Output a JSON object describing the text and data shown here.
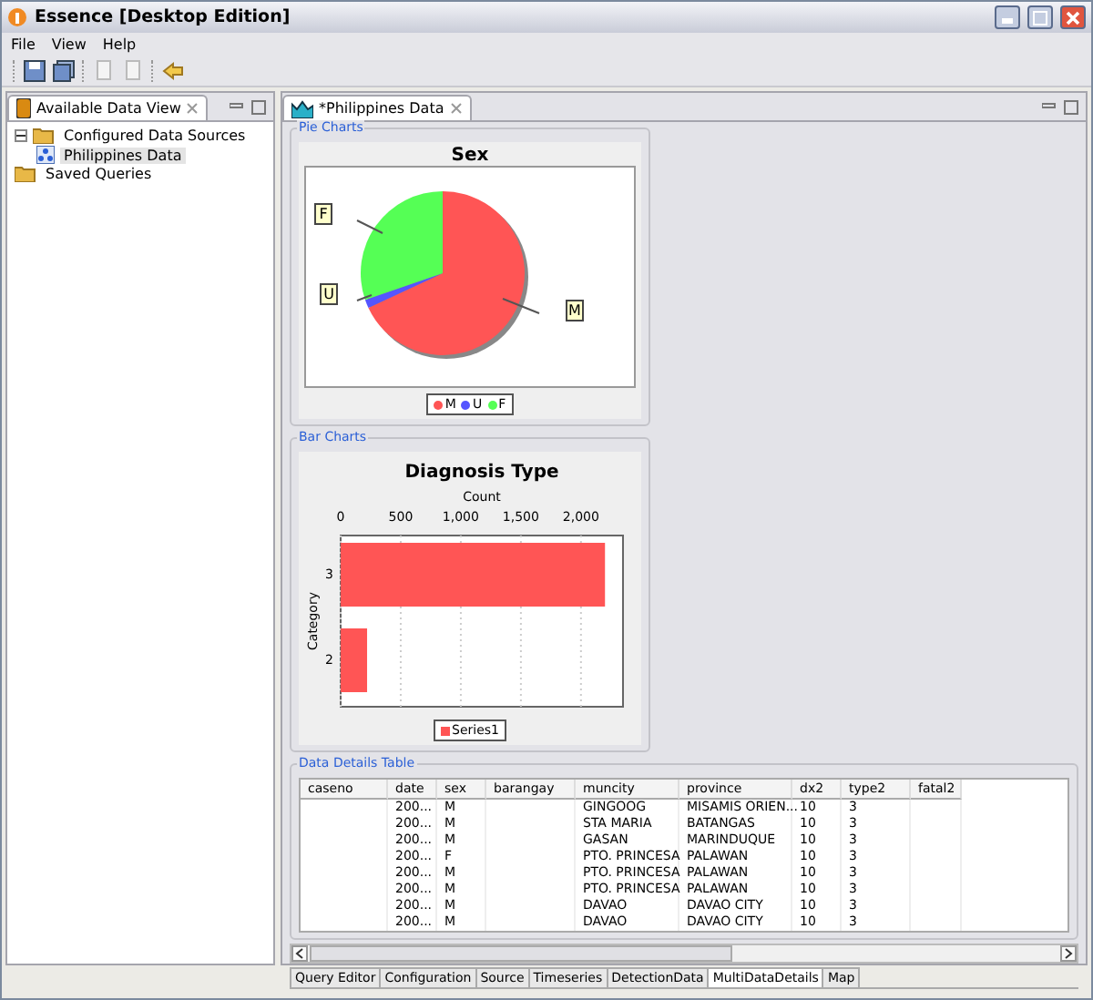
{
  "window": {
    "title": "Essence [Desktop Edition]"
  },
  "menu": [
    "File",
    "View",
    "Help"
  ],
  "left_view": {
    "tab": "Available Data View",
    "tree": [
      {
        "label": "Configured Data Sources",
        "expanded": true,
        "selected": false,
        "children": [
          {
            "label": "Philippines Data",
            "selected": true
          }
        ]
      },
      {
        "label": "Saved Queries",
        "selected": false
      }
    ]
  },
  "editor": {
    "tab": "*Philippines Data",
    "pie_group": {
      "title": "Pie Charts",
      "chart_title": "Sex",
      "callouts": [
        "M",
        "U",
        "F"
      ],
      "slices": [
        {
          "label": "M",
          "color": "#ff5555"
        },
        {
          "label": "U",
          "color": "#5555ff"
        },
        {
          "label": "F",
          "color": "#55ff55"
        }
      ]
    },
    "bar_group": {
      "title": "Bar Charts",
      "chart_data": {
        "type": "bar",
        "orientation": "horizontal",
        "grid": true,
        "title": "Diagnosis Type",
        "xlabel": "Count",
        "ylabel": "Category",
        "categories": [
          "3",
          "2"
        ],
        "series": [
          {
            "name": "Series1",
            "color": "#ff5555",
            "values": [
              2200,
              220
            ]
          }
        ],
        "xlim": [
          0,
          2350
        ],
        "xticks": [
          {
            "value": 0,
            "label": "0"
          },
          {
            "value": 500,
            "label": "500"
          },
          {
            "value": 1000,
            "label": "1,000"
          },
          {
            "value": 1500,
            "label": "1,500"
          },
          {
            "value": 2000,
            "label": "2,000"
          }
        ]
      }
    },
    "table_group": {
      "title": "Data Details Table",
      "columns": [
        "caseno",
        "date",
        "sex",
        "barangay",
        "muncity",
        "province",
        "dx2",
        "type2",
        "fatal2"
      ],
      "rows": [
        [
          null,
          "200...",
          "M",
          null,
          "GINGOOG",
          "MISAMIS ORIEN...",
          "10",
          "3",
          null
        ],
        [
          null,
          "200...",
          "M",
          null,
          "STA MARIA",
          "BATANGAS",
          "10",
          "3",
          null
        ],
        [
          null,
          "200...",
          "M",
          null,
          "GASAN",
          "MARINDUQUE",
          "10",
          "3",
          null
        ],
        [
          null,
          "200...",
          "F",
          null,
          "PTO. PRINCESA",
          "PALAWAN",
          "10",
          "3",
          null
        ],
        [
          null,
          "200...",
          "M",
          null,
          "PTO. PRINCESA",
          "PALAWAN",
          "10",
          "3",
          null
        ],
        [
          null,
          "200...",
          "M",
          null,
          "PTO. PRINCESA",
          "PALAWAN",
          "10",
          "3",
          null
        ],
        [
          null,
          "200...",
          "M",
          null,
          "DAVAO",
          "DAVAO CITY",
          "10",
          "3",
          null
        ],
        [
          null,
          "200...",
          "M",
          null,
          "DAVAO",
          "DAVAO CITY",
          "10",
          "3",
          null
        ]
      ]
    },
    "bottom_tabs": [
      {
        "label": "Query Editor",
        "selected": false
      },
      {
        "label": "Configuration",
        "selected": false
      },
      {
        "label": "Source",
        "selected": false
      },
      {
        "label": "Timeseries",
        "selected": false
      },
      {
        "label": "DetectionData",
        "selected": false
      },
      {
        "label": "MultiDataDetails",
        "selected": true
      },
      {
        "label": "Map",
        "selected": false
      }
    ]
  }
}
